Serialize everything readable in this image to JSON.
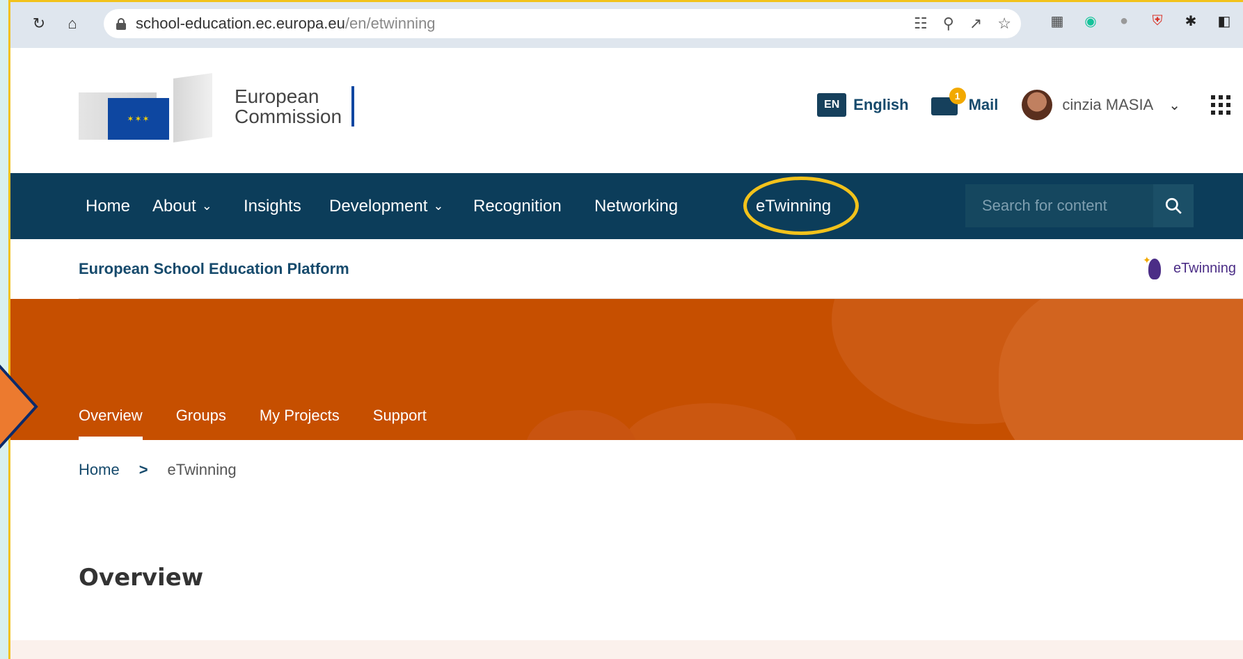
{
  "browser": {
    "url_host": "school-education.ec.europa.eu",
    "url_path": "/en/etwinning"
  },
  "header": {
    "logo_line1": "European",
    "logo_line2": "Commission",
    "lang_code": "EN",
    "lang_label": "English",
    "mail_count": "1",
    "mail_label": "Mail",
    "user_name": "cinzia MASIA"
  },
  "mainnav": {
    "items": [
      {
        "label": "Home"
      },
      {
        "label": "About",
        "caret": true
      },
      {
        "label": "Insights"
      },
      {
        "label": "Development",
        "caret": true
      },
      {
        "label": "Recognition"
      },
      {
        "label": "Networking"
      },
      {
        "label": "eTwinning"
      }
    ],
    "search_placeholder": "Search for content"
  },
  "platform": {
    "title": "European School Education Platform",
    "etwinning_logo_text": "eTwinning"
  },
  "subnav": {
    "tabs": [
      {
        "label": "Overview"
      },
      {
        "label": "Groups"
      },
      {
        "label": "My Projects"
      },
      {
        "label": "Support"
      }
    ]
  },
  "breadcrumb": {
    "home": "Home",
    "separator": ">",
    "current": "eTwinning"
  },
  "page": {
    "heading": "Overview"
  },
  "colors": {
    "nav_bg": "#0c3d5a",
    "banner_bg": "#c64f00",
    "highlight": "#f2c21b",
    "brand_blue": "#164a6c"
  }
}
